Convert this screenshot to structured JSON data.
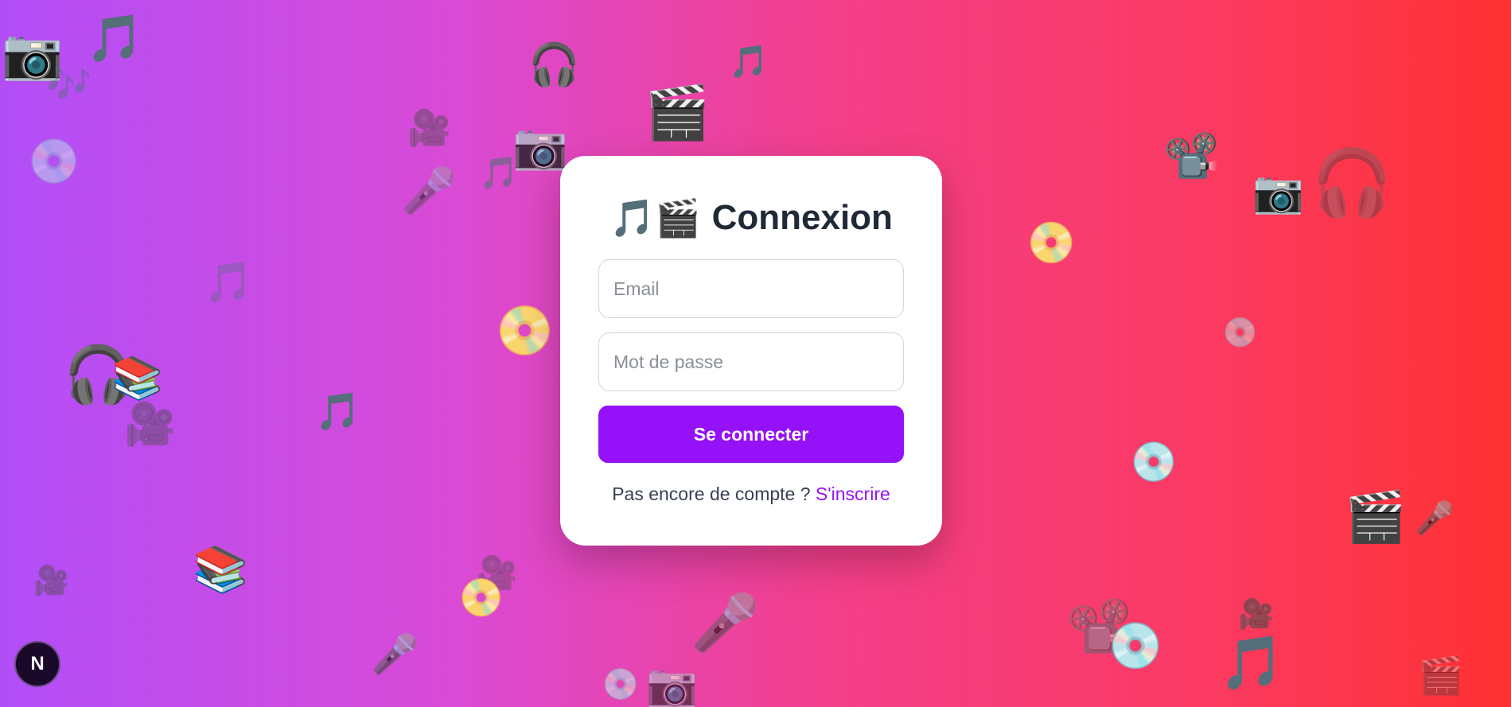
{
  "login": {
    "title_emoji": "🎵🎬",
    "title": "Connexion",
    "email": {
      "placeholder": "Email",
      "value": ""
    },
    "password": {
      "placeholder": "Mot de passe",
      "value": ""
    },
    "submit_label": "Se connecter",
    "signup_prompt": "Pas encore de compte ? ",
    "signup_link": "S'inscrire"
  },
  "dev_badge": {
    "label": "N",
    "icon": "nextjs-dev-indicator"
  },
  "decorations": {
    "icons": [
      "camera-icon",
      "music-note-icon",
      "cd-icon",
      "headphones-icon",
      "clapperboard-icon",
      "microphone-icon",
      "movie-camera-icon",
      "books-icon",
      "radio-icon",
      "projector-icon"
    ],
    "glyphs": {
      "camera": "📷",
      "music": "🎵",
      "music2": "🎶",
      "cd": "📀",
      "disc": "💿",
      "headphones": "🎧",
      "clapper": "🎬",
      "mic": "🎤",
      "movie_camera": "🎥",
      "books": "📚",
      "projector": "📽️"
    }
  },
  "colors": {
    "gradient_start": "#b24ef8",
    "gradient_end": "#fe3131",
    "accent": "#9511f8",
    "title_text": "#1f2937"
  }
}
